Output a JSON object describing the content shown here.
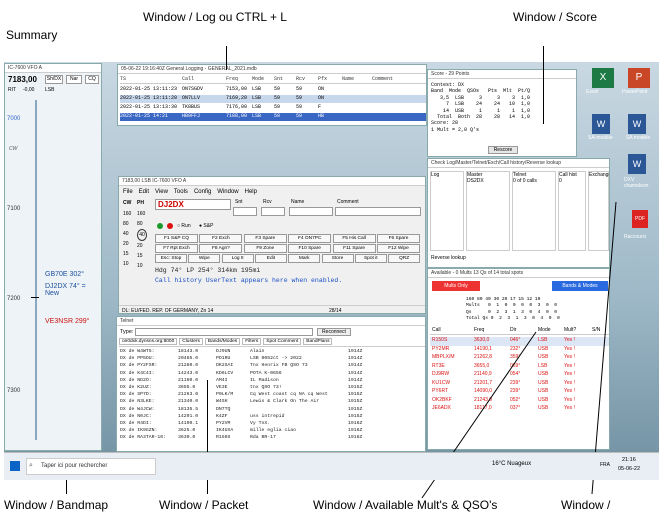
{
  "captions": {
    "summary": "Summary",
    "log": "Window / Log  ou  CTRL + L",
    "score": "Window / Score",
    "bandmap": "Window / Bandmap",
    "packet": "Window / Packet",
    "mults": "Window / Available Mult's & QSO's",
    "last": "Window /"
  },
  "bandmap": {
    "title": "IC-7600 VFO A",
    "freq": "7183,00",
    "btn1": "Sh/DX",
    "btn2": "Nar",
    "btn3": "CQ",
    "rit": "RIT",
    "rit_val": "-0,00",
    "mode": "LSB",
    "ticks": [
      "7000",
      "CW",
      "7100",
      "7200",
      "7300"
    ],
    "spots": [
      "GB70E 302°",
      "DJ2DX 74° = New",
      "VE3NSR 299°"
    ]
  },
  "log": {
    "title": "05-06-22 19:16:40Z  General Logging - GENERAL_2021.mdb",
    "headers": [
      "TS",
      "Call",
      "Freq",
      "Mode",
      "Snt",
      "Rcv",
      "Pfx",
      "Name",
      "Comment"
    ],
    "rows": [
      [
        "2022-01-25 13:11:23",
        "ON7SGDV",
        "7153,00",
        "LSB",
        "59",
        "59",
        "ON"
      ],
      [
        "2022-01-25 13:11:20",
        "ON7LLV",
        "7169,20",
        "LSB",
        "59",
        "59",
        "ON"
      ],
      [
        "2022-01-25 13:13:30",
        "TK8BUS",
        "7176,00",
        "LSB",
        "59",
        "59",
        "F"
      ],
      [
        "2022-01-25 14:21",
        "HB9FFJ",
        "7188,00",
        "LSB",
        "59",
        "59",
        "HB"
      ]
    ]
  },
  "score": {
    "title": "Score - 29 Points",
    "contest": "Contest: DX",
    "header": "Band  Mode  QSOs   Pts  Mlt  Pt/Q",
    "rows": [
      "   3,5  LSB     3     3    3  1,0",
      "     7  LSB    24    24   10  1,0",
      "    14  USB     1     1    1  1,0",
      "  Total  Both  28    28   14  1,0"
    ],
    "score": "Score: 28",
    "mult": "1 Mult = 2,0 Q's",
    "rescore": "Rescore"
  },
  "entry": {
    "title": "7183,00 LSB  IC-7600 VFO A",
    "menus": [
      "File",
      "Edit",
      "View",
      "Tools",
      "Config",
      "Window",
      "Help"
    ],
    "call": "DJ2DX",
    "labels": [
      "Snt",
      "Rcv",
      "Name",
      "Comment"
    ],
    "run": "Run",
    "sp": "S&P",
    "fkeys": [
      "F1 S&P CQ",
      "F2 Exch",
      "F3 Spare",
      "F4 ON7PC",
      "F5 His Call",
      "F6 Spare",
      "F7 Rpt Exch",
      "F8 Agn?",
      "F9 Zone",
      "F10 Spare",
      "F11 Spare",
      "F12 Wipe",
      "Esc: Stop",
      "Wipe",
      "Log It",
      "Edit",
      "Mark",
      "Store",
      "Spot it",
      "QRZ"
    ],
    "hdg": "Hdg  74° LP 254° 314km 195mi",
    "info": "Call history UserText appears here when enabled.",
    "status": "DL: EU/FED. REP. OF GERMANY, Zn 14",
    "zone": "28/14",
    "cw": "CW",
    "ph": "PH",
    "wpm": [
      "160",
      "80",
      "40",
      "20",
      "15",
      "10"
    ],
    "nums": [
      "160",
      "80",
      "40",
      "20",
      "15",
      "10"
    ]
  },
  "telnet": {
    "title": "Telnet",
    "type": "Type:",
    "reconnect": "Reconnect",
    "tabs": [
      "on0dxk.dynsns.org:8000",
      "Clusters",
      "Bands/Modes",
      "Filters",
      "Spot Comment",
      "BandPlans"
    ],
    "rows": [
      [
        "DX de W4WT5:",
        "18143.0",
        "DJ9UN",
        "Alain",
        "1914Z"
      ],
      [
        "DX de PP5DU:",
        "20485.0",
        "PD1RU",
        "LSB 0052ct -> 2022",
        "1914Z"
      ],
      [
        "DX de PY2FSR:",
        "21280.0",
        "DK2SAI",
        "Tnx Henrix FB QSO 73",
        "1914Z"
      ],
      [
        "DX de K4C4I:",
        "14243.0",
        "KD6LCV",
        "POTA K-0656",
        "1914Z"
      ],
      [
        "DX de ND2O:",
        "21160.0",
        "AM4I",
        "IL Madison",
        "1914Z"
      ],
      [
        "DX de K2UZ:",
        "3655.0",
        "VE3E",
        "tnx QSO 73!",
        "1915Z"
      ],
      [
        "DX de SP7D:",
        "21263.0",
        "P0LK/M",
        "Cq West coast cq NA cq West",
        "1915Z"
      ],
      [
        "DX de N3LKE:",
        "21340.0",
        "W4SH",
        "Lewis & Clark On The Air",
        "1915Z"
      ],
      [
        "DX de W4JCW:",
        "18135.5",
        "DN7TQ",
        "",
        "1915Z"
      ],
      [
        "DX de N0JC:",
        "14291.0",
        "K4ZF",
        "uss intrepid",
        "1915Z"
      ],
      [
        "DX de R4DI:",
        "14190.1",
        "PY2VM",
        "Vy TnX.",
        "1916Z"
      ],
      [
        "DX de IK9GZN:",
        "3625.0",
        "IK4UXA",
        "mille eglia ciao",
        "1916Z"
      ],
      [
        "DX de RA3TAR-10:",
        "3630.0",
        "R150S",
        "Rda BR-17",
        "1916Z"
      ]
    ]
  },
  "check": {
    "title": "Check Log/Master/Telnet/Exch/Call history/Reverse lookup",
    "headers": [
      "Log",
      "Master",
      "Telnet",
      "Call hist",
      "Exchanges"
    ],
    "vals": [
      "",
      "DS2DX",
      "0 of 0 calls",
      "0",
      ""
    ],
    "reverse": "Reverse lookup"
  },
  "available": {
    "title": "Available - 0 Mults 13 Qs of 14 total spots",
    "mults_only": "Mults Only",
    "bands_modes": "Bands & Modes",
    "grid_head": "160 80 40 30 20 17 15 12 10",
    "mults": "Mults   0  1  0  0  0  0  3  0  0",
    "qs": "Qs      0  2  3  1  3  0  4  0  0",
    "total": "Total Qs 0  2  3  1  3  0  4  0  0",
    "headers": [
      "Call",
      "Freq",
      "Dir",
      "Mode",
      "Mult?",
      "S/N"
    ],
    "rows": [
      [
        "R150S",
        "3630,0",
        "046°",
        "LSB",
        "Yes !"
      ],
      [
        "PY2MR",
        "14190,1",
        "232°",
        "USB",
        "Yes !"
      ],
      [
        "MBPLX/M",
        "21262,8",
        "359°",
        "USB",
        "Yes !"
      ],
      [
        "RT3E",
        "3655,0",
        "069°",
        "LSB",
        "Yes !"
      ],
      [
        "DJ9RW",
        "21140,9",
        "054°",
        "USB",
        "Yes !"
      ],
      [
        "KU1CW",
        "21201,7",
        "239°",
        "USB",
        "Yes !"
      ],
      [
        "PY6RT",
        "14090,0",
        "239°",
        "USB",
        "Yes !"
      ],
      [
        "OK2BKF",
        "21243,9",
        "052°",
        "USB",
        "Yes !"
      ],
      [
        "JE6ADX",
        "18117,0",
        "037°",
        "USB",
        "Yes !"
      ]
    ]
  },
  "taskbar": {
    "search": "Taper ici pour rechercher",
    "weather": "16°C  Nuageux",
    "lang": "FRA",
    "time": "21:16",
    "date": "05-06-22"
  },
  "desktop": [
    "Excel",
    "PowerPoint",
    "SA-modèle",
    "SA modèle",
    "DXV chameleon",
    "Raccourci"
  ]
}
